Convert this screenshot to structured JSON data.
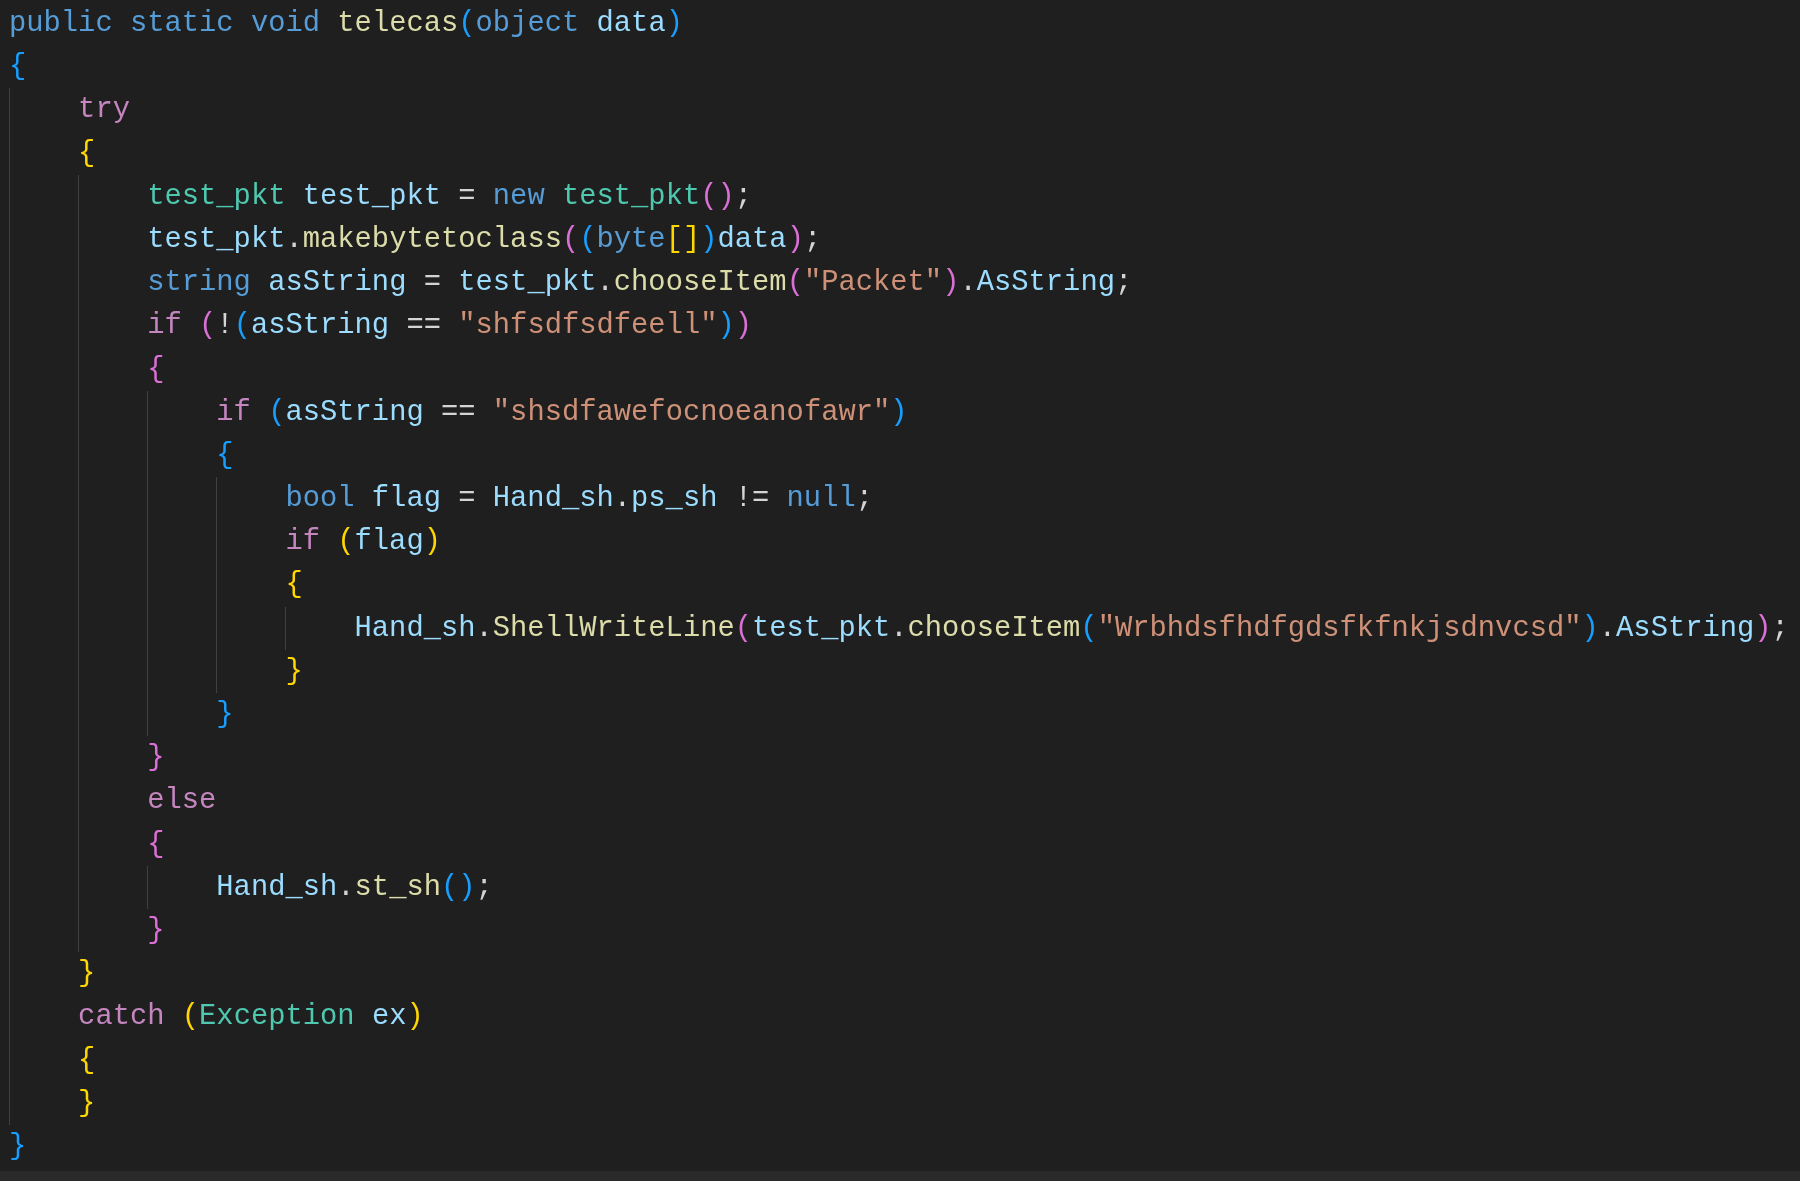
{
  "editor": {
    "lines": [
      {
        "tokens": [
          {
            "kind": "k",
            "text": "public static void "
          },
          {
            "kind": "f",
            "text": "telecas"
          },
          {
            "kind": "b",
            "text": "("
          },
          {
            "kind": "k",
            "text": "object "
          },
          {
            "kind": "v",
            "text": "data"
          },
          {
            "kind": "b",
            "text": ")"
          }
        ]
      },
      {
        "tokens": [
          {
            "kind": "b",
            "text": "{"
          }
        ],
        "children": [
          {
            "tokens": [
              {
                "kind": "c",
                "text": "try"
              }
            ]
          },
          {
            "tokens": [
              {
                "kind": "y",
                "text": "{"
              }
            ],
            "children": [
              {
                "tokens": [
                  {
                    "kind": "t",
                    "text": "test_pkt "
                  },
                  {
                    "kind": "v",
                    "text": "test_pkt"
                  },
                  {
                    "kind": "p",
                    "text": " = "
                  },
                  {
                    "kind": "k",
                    "text": "new "
                  },
                  {
                    "kind": "t",
                    "text": "test_pkt"
                  },
                  {
                    "kind": "m",
                    "text": "()"
                  },
                  {
                    "kind": "p",
                    "text": ";"
                  }
                ]
              },
              {
                "tokens": [
                  {
                    "kind": "v",
                    "text": "test_pkt"
                  },
                  {
                    "kind": "p",
                    "text": "."
                  },
                  {
                    "kind": "f",
                    "text": "makebytetoclass"
                  },
                  {
                    "kind": "m",
                    "text": "("
                  },
                  {
                    "kind": "b",
                    "text": "("
                  },
                  {
                    "kind": "k",
                    "text": "byte"
                  },
                  {
                    "kind": "y",
                    "text": "[]"
                  },
                  {
                    "kind": "b",
                    "text": ")"
                  },
                  {
                    "kind": "v",
                    "text": "data"
                  },
                  {
                    "kind": "m",
                    "text": ")"
                  },
                  {
                    "kind": "p",
                    "text": ";"
                  }
                ]
              },
              {
                "tokens": [
                  {
                    "kind": "k",
                    "text": "string "
                  },
                  {
                    "kind": "v",
                    "text": "asString"
                  },
                  {
                    "kind": "p",
                    "text": " = "
                  },
                  {
                    "kind": "v",
                    "text": "test_pkt"
                  },
                  {
                    "kind": "p",
                    "text": "."
                  },
                  {
                    "kind": "f",
                    "text": "chooseItem"
                  },
                  {
                    "kind": "m",
                    "text": "("
                  },
                  {
                    "kind": "s",
                    "text": "\"Packet\""
                  },
                  {
                    "kind": "m",
                    "text": ")"
                  },
                  {
                    "kind": "p",
                    "text": "."
                  },
                  {
                    "kind": "v",
                    "text": "AsString"
                  },
                  {
                    "kind": "p",
                    "text": ";"
                  }
                ]
              },
              {
                "tokens": [
                  {
                    "kind": "c",
                    "text": "if "
                  },
                  {
                    "kind": "m",
                    "text": "("
                  },
                  {
                    "kind": "p",
                    "text": "!"
                  },
                  {
                    "kind": "b",
                    "text": "("
                  },
                  {
                    "kind": "v",
                    "text": "asString"
                  },
                  {
                    "kind": "p",
                    "text": " == "
                  },
                  {
                    "kind": "s",
                    "text": "\"shfsdfsdfeell\""
                  },
                  {
                    "kind": "b",
                    "text": ")"
                  },
                  {
                    "kind": "m",
                    "text": ")"
                  }
                ]
              },
              {
                "tokens": [
                  {
                    "kind": "m",
                    "text": "{"
                  }
                ],
                "children": [
                  {
                    "tokens": [
                      {
                        "kind": "c",
                        "text": "if "
                      },
                      {
                        "kind": "b",
                        "text": "("
                      },
                      {
                        "kind": "v",
                        "text": "asString"
                      },
                      {
                        "kind": "p",
                        "text": " == "
                      },
                      {
                        "kind": "s",
                        "text": "\"shsdfawefocnoeanofawr\""
                      },
                      {
                        "kind": "b",
                        "text": ")"
                      }
                    ]
                  },
                  {
                    "tokens": [
                      {
                        "kind": "b",
                        "text": "{"
                      }
                    ],
                    "children": [
                      {
                        "tokens": [
                          {
                            "kind": "k",
                            "text": "bool "
                          },
                          {
                            "kind": "v",
                            "text": "flag"
                          },
                          {
                            "kind": "p",
                            "text": " = "
                          },
                          {
                            "kind": "v",
                            "text": "Hand_sh"
                          },
                          {
                            "kind": "p",
                            "text": "."
                          },
                          {
                            "kind": "v",
                            "text": "ps_sh"
                          },
                          {
                            "kind": "p",
                            "text": " != "
                          },
                          {
                            "kind": "k",
                            "text": "null"
                          },
                          {
                            "kind": "p",
                            "text": ";"
                          }
                        ]
                      },
                      {
                        "tokens": [
                          {
                            "kind": "c",
                            "text": "if "
                          },
                          {
                            "kind": "y",
                            "text": "("
                          },
                          {
                            "kind": "v",
                            "text": "flag"
                          },
                          {
                            "kind": "y",
                            "text": ")"
                          }
                        ]
                      },
                      {
                        "tokens": [
                          {
                            "kind": "y",
                            "text": "{"
                          }
                        ],
                        "children": [
                          {
                            "tokens": [
                              {
                                "kind": "v",
                                "text": "Hand_sh"
                              },
                              {
                                "kind": "p",
                                "text": "."
                              },
                              {
                                "kind": "f",
                                "text": "ShellWriteLine"
                              },
                              {
                                "kind": "m",
                                "text": "("
                              },
                              {
                                "kind": "v",
                                "text": "test_pkt"
                              },
                              {
                                "kind": "p",
                                "text": "."
                              },
                              {
                                "kind": "f",
                                "text": "chooseItem"
                              },
                              {
                                "kind": "b",
                                "text": "("
                              },
                              {
                                "kind": "s",
                                "text": "\"Wrbhdsfhdfgdsfkfnkjsdnvcsd\""
                              },
                              {
                                "kind": "b",
                                "text": ")"
                              },
                              {
                                "kind": "p",
                                "text": "."
                              },
                              {
                                "kind": "v",
                                "text": "AsString"
                              },
                              {
                                "kind": "m",
                                "text": ")"
                              },
                              {
                                "kind": "p",
                                "text": ";"
                              }
                            ]
                          }
                        ]
                      },
                      {
                        "tokens": [
                          {
                            "kind": "y",
                            "text": "}"
                          }
                        ]
                      }
                    ]
                  },
                  {
                    "tokens": [
                      {
                        "kind": "b",
                        "text": "}"
                      }
                    ]
                  }
                ]
              },
              {
                "tokens": [
                  {
                    "kind": "m",
                    "text": "}"
                  }
                ]
              },
              {
                "tokens": [
                  {
                    "kind": "c",
                    "text": "else"
                  }
                ]
              },
              {
                "tokens": [
                  {
                    "kind": "m",
                    "text": "{"
                  }
                ],
                "children": [
                  {
                    "tokens": [
                      {
                        "kind": "v",
                        "text": "Hand_sh"
                      },
                      {
                        "kind": "p",
                        "text": "."
                      },
                      {
                        "kind": "f",
                        "text": "st_sh"
                      },
                      {
                        "kind": "b",
                        "text": "()"
                      },
                      {
                        "kind": "p",
                        "text": ";"
                      }
                    ]
                  }
                ]
              },
              {
                "tokens": [
                  {
                    "kind": "m",
                    "text": "}"
                  }
                ]
              }
            ]
          },
          {
            "tokens": [
              {
                "kind": "y",
                "text": "}"
              }
            ]
          },
          {
            "tokens": [
              {
                "kind": "c",
                "text": "catch "
              },
              {
                "kind": "y",
                "text": "("
              },
              {
                "kind": "t",
                "text": "Exception "
              },
              {
                "kind": "v",
                "text": "ex"
              },
              {
                "kind": "y",
                "text": ")"
              }
            ]
          },
          {
            "tokens": [
              {
                "kind": "y",
                "text": "{"
              }
            ]
          },
          {
            "tokens": [
              {
                "kind": "y",
                "text": "}"
              }
            ]
          }
        ]
      },
      {
        "tokens": [
          {
            "kind": "b",
            "text": "}"
          }
        ]
      }
    ]
  }
}
